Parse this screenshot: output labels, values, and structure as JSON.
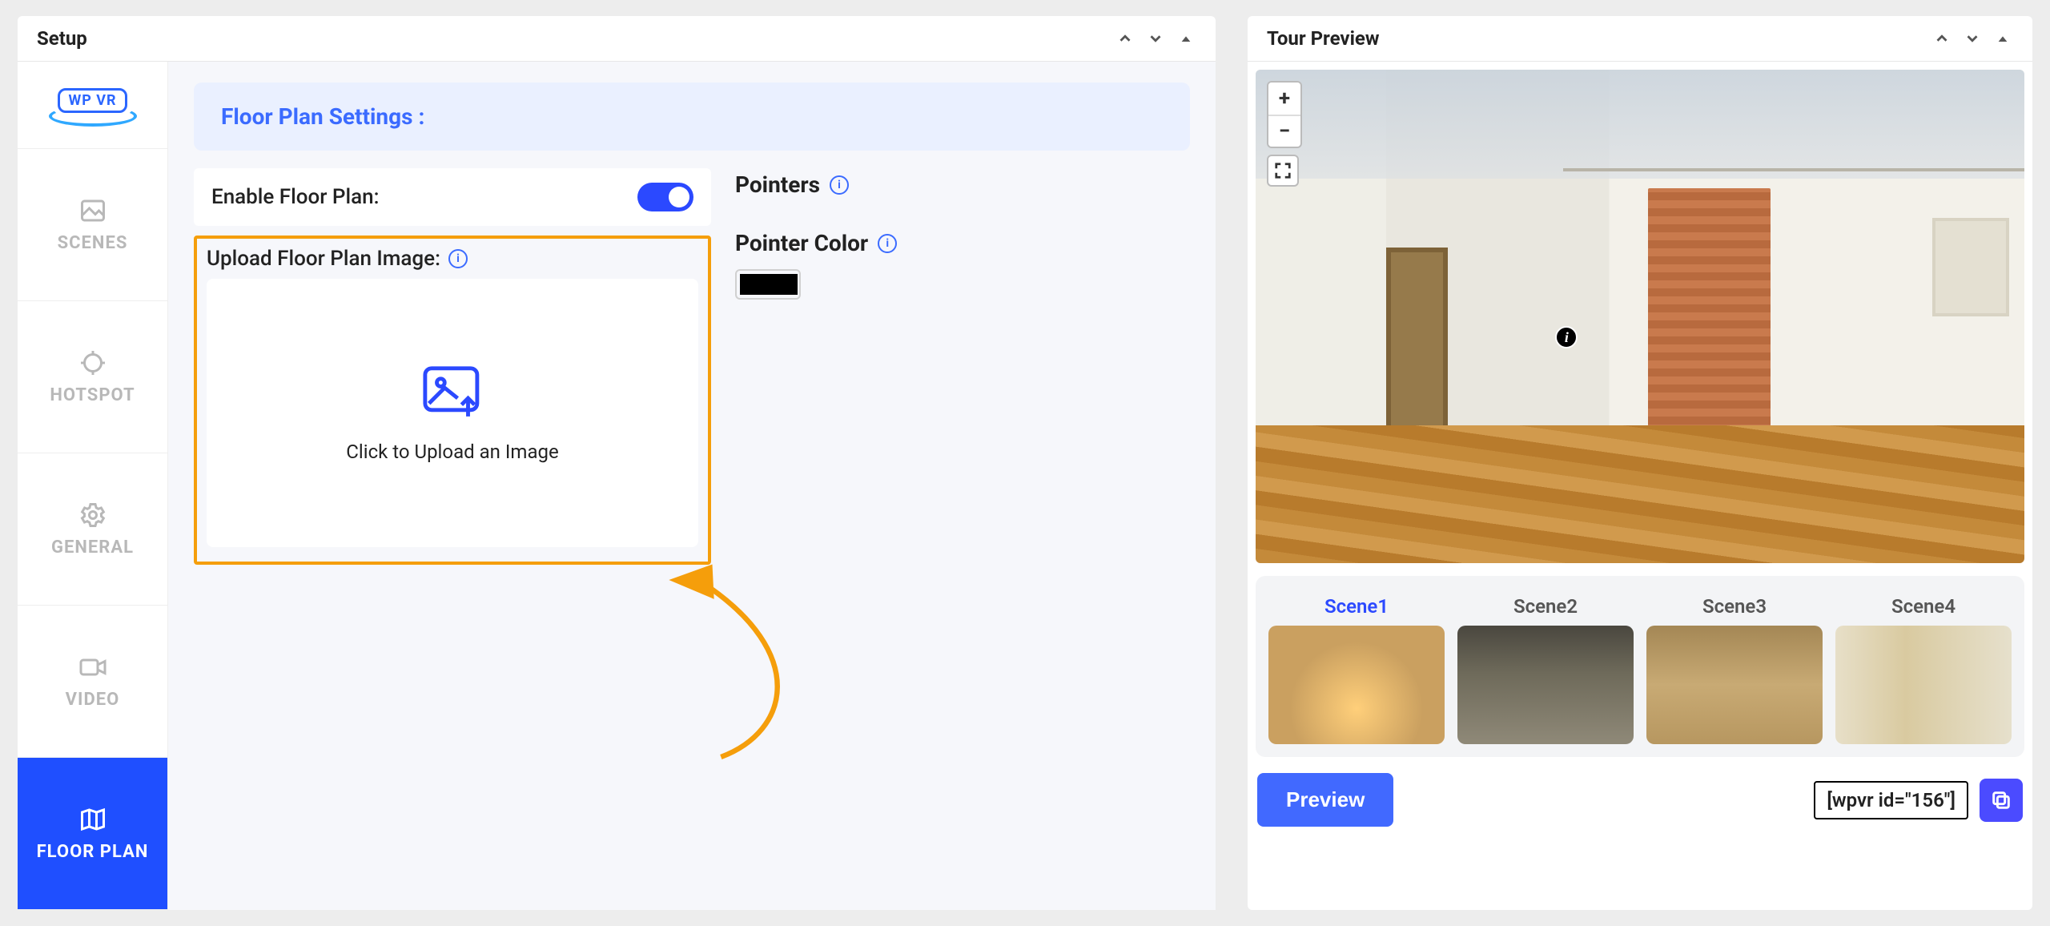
{
  "setup": {
    "title": "Setup",
    "logo_text": "WP VR",
    "sidebar": [
      {
        "id": "scenes",
        "label": "SCENES",
        "icon": "image"
      },
      {
        "id": "hotspot",
        "label": "HOTSPOT",
        "icon": "target"
      },
      {
        "id": "general",
        "label": "GENERAL",
        "icon": "gear"
      },
      {
        "id": "video",
        "label": "VIDEO",
        "icon": "video"
      },
      {
        "id": "floorplan",
        "label": "FLOOR PLAN",
        "icon": "map",
        "active": true
      }
    ],
    "floorplan": {
      "section_title": "Floor Plan Settings :",
      "enable_label": "Enable Floor Plan:",
      "enable_value": true,
      "upload_label": "Upload Floor Plan Image:",
      "upload_cta": "Click to Upload an Image",
      "pointers_header": "Pointers",
      "pointer_color_label": "Pointer Color",
      "pointer_color_value": "#000000"
    }
  },
  "preview": {
    "title": "Tour Preview",
    "zoom_in": "+",
    "zoom_out": "−",
    "scenes": [
      {
        "name": "Scene1",
        "active": true
      },
      {
        "name": "Scene2"
      },
      {
        "name": "Scene3"
      },
      {
        "name": "Scene4"
      }
    ],
    "preview_button": "Preview",
    "shortcode": "[wpvr id=\"156\"]"
  }
}
